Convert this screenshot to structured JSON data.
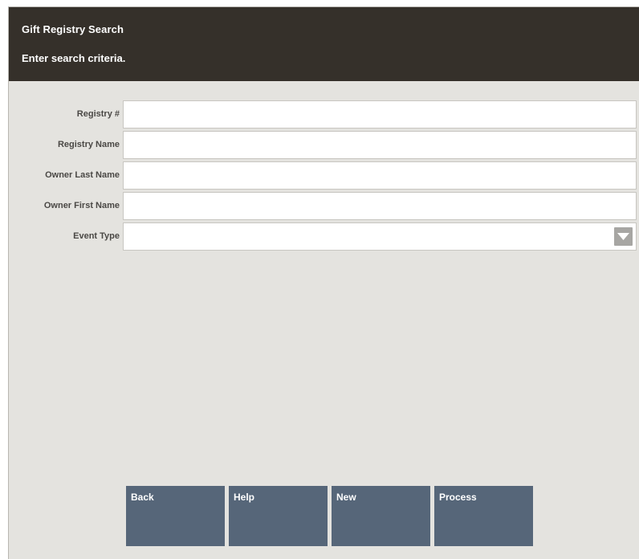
{
  "header": {
    "title": "Gift Registry Search",
    "prompt": "Enter search criteria."
  },
  "form": {
    "fields": [
      {
        "label": "Registry #",
        "value": ""
      },
      {
        "label": "Registry Name",
        "value": ""
      },
      {
        "label": "Owner Last Name",
        "value": ""
      },
      {
        "label": "Owner First Name",
        "value": ""
      }
    ],
    "event_type": {
      "label": "Event Type",
      "value": "",
      "icon": "dropdown-arrow-icon"
    }
  },
  "buttons": {
    "back": "Back",
    "help": "Help",
    "new": "New",
    "process": "Process"
  },
  "colors": {
    "header_bg": "#35302a",
    "body_bg": "#e4e3df",
    "button_bg": "#566679"
  }
}
